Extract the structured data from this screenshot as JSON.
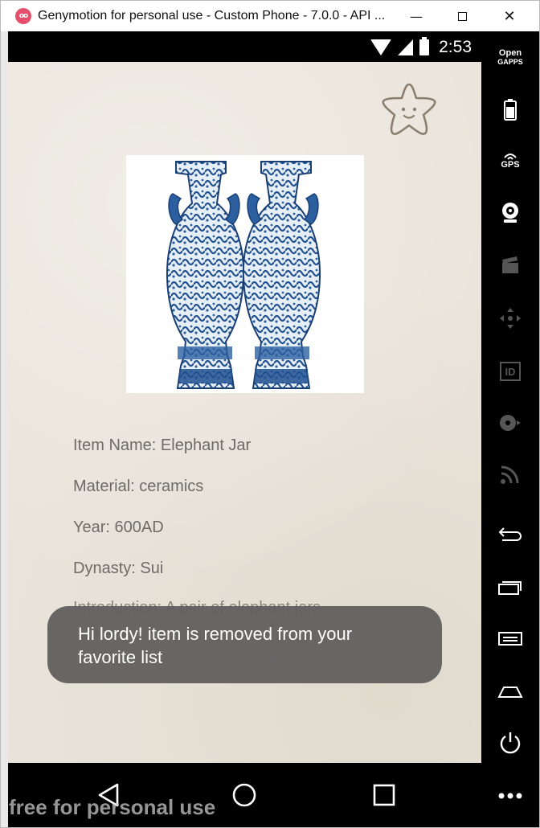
{
  "window": {
    "title": "Genymotion for personal use - Custom Phone - 7.0.0 - API ...",
    "icon_text": "oo",
    "minimize_icon": "minimize-icon",
    "maximize_icon": "maximize-icon",
    "close_icon": "close-icon"
  },
  "status_bar": {
    "time": "2:53",
    "icons": [
      "wifi-icon",
      "cell-signal-icon",
      "battery-icon"
    ]
  },
  "detail": {
    "favorite_icon": "star-face-icon",
    "image_subject": "pair of blue-and-white porcelain elephant jars",
    "item_name": "Item Name: Elephant Jar",
    "material": "Material: ceramics",
    "year": "Year: 600AD",
    "dynasty": "Dynasty: Sui",
    "introduction_partial": "Introduction: A pair of elephant jars"
  },
  "toast": {
    "message": "Hi lordy! item is removed from your favorite list"
  },
  "nav_bar": {
    "buttons": [
      "back-icon",
      "home-icon",
      "recents-icon"
    ]
  },
  "sidebar": {
    "opengapps_line1": "Open",
    "opengapps_line2": "GAPPS",
    "gps_label": "GPS",
    "id_label": "ID"
  },
  "watermark": "free for personal use",
  "colors": {
    "content_background": "#e9e4da",
    "text_gray": "#6e6b67",
    "toast_background": "#62615f",
    "star_outline": "#8a7f6f",
    "porcelain_blue": "#1f4f8f"
  }
}
